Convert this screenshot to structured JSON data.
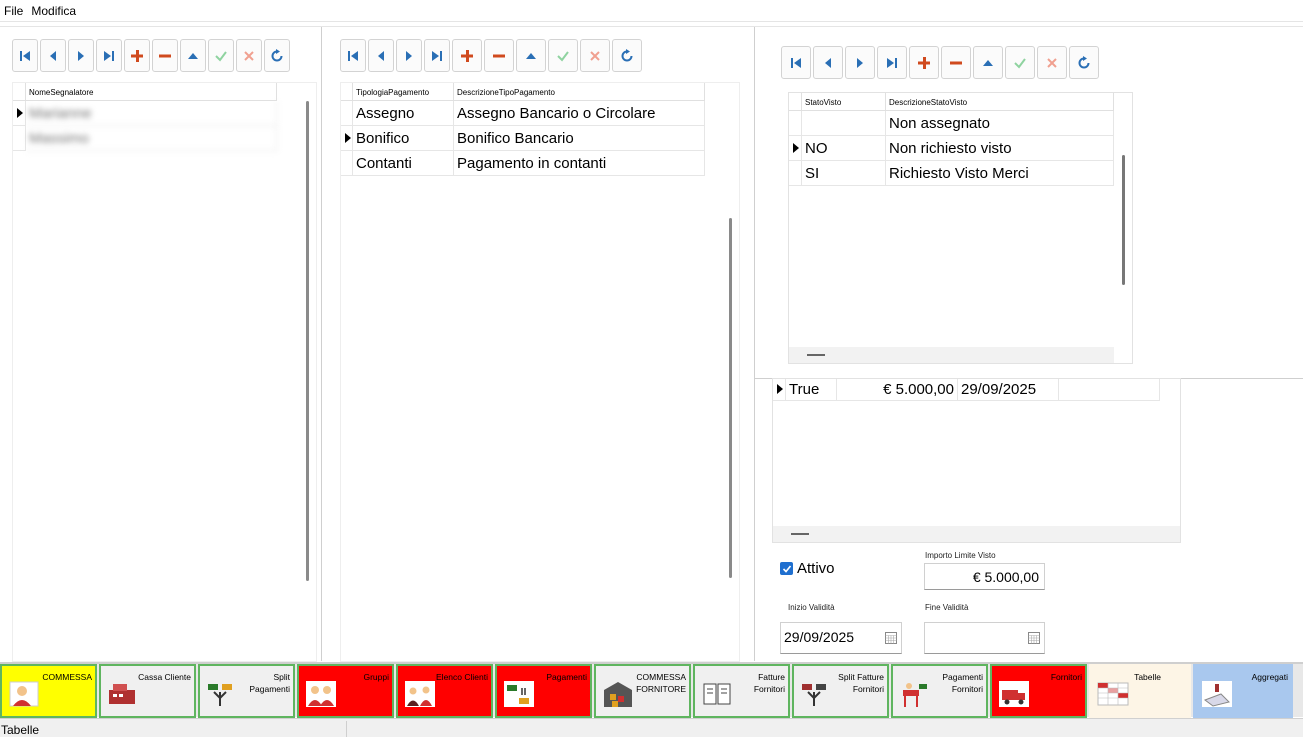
{
  "menu": {
    "file": "File",
    "modifica": "Modifica"
  },
  "icons": {
    "first": "first-record-icon",
    "prev": "previous-record-icon",
    "next": "next-record-icon",
    "last": "last-record-icon",
    "add": "add-icon",
    "remove": "remove-icon",
    "up": "up-icon",
    "confirm": "confirm-icon",
    "cancel": "cancel-icon",
    "refresh": "refresh-icon"
  },
  "panel1": {
    "header": [
      "NomeSegnalatore"
    ],
    "rows": [
      [
        "Marianne"
      ],
      [
        "Massimo"
      ]
    ]
  },
  "panel2": {
    "header": [
      "TipologiaPagamento",
      "DescrizioneTipoPagamento"
    ],
    "rows": [
      [
        "Assegno",
        "Assegno Bancario o Circolare"
      ],
      [
        "Bonifico",
        "Bonifico Bancario"
      ],
      [
        "Contanti",
        "Pagamento in contanti"
      ]
    ]
  },
  "panel3": {
    "header": [
      "StatoVisto",
      "DescrizioneStatoVisto"
    ],
    "rows": [
      [
        "",
        "Non assegnato"
      ],
      [
        "NO",
        "Non richiesto visto"
      ],
      [
        "SI",
        "Richiesto Visto Merci"
      ]
    ],
    "detail_row": [
      "True",
      "€ 5.000,00",
      "29/09/2025",
      ""
    ]
  },
  "form": {
    "attivo_label": "Attivo",
    "importo_label": "Importo Limite Visto",
    "importo_value": "€ 5.000,00",
    "inizio_label": "Inizio Validità",
    "inizio_value": "29/09/2025",
    "fine_label": "Fine Validità",
    "fine_value": ""
  },
  "tabs": [
    {
      "label": "COMMESSA",
      "bg": "#ffff00",
      "icon": "worker-icon"
    },
    {
      "label": "Cassa Cliente",
      "bg": "#f0f0f0",
      "icon": "cash-register-icon"
    },
    {
      "label": "Split\nPagamenti",
      "bg": "#f0f0f0",
      "icon": "split-payment-icon"
    },
    {
      "label": "Gruppi",
      "bg": "#ff0000",
      "icon": "group-icon"
    },
    {
      "label": "Elenco Clienti",
      "bg": "#ff0000",
      "icon": "clients-icon"
    },
    {
      "label": "Pagamenti",
      "bg": "#ff0000",
      "icon": "payment-icon"
    },
    {
      "label": "COMMESSA\nFORNITORE",
      "bg": "#f0f0f0",
      "icon": "warehouse-icon"
    },
    {
      "label": "Fatture\nFornitori",
      "bg": "#f0f0f0",
      "icon": "invoice-icon"
    },
    {
      "label": "Split Fatture\nFornitori",
      "bg": "#f0f0f0",
      "icon": "split-invoice-icon"
    },
    {
      "label": "Pagamenti\nFornitori",
      "bg": "#f0f0f0",
      "icon": "supplier-payment-icon"
    },
    {
      "label": "Fornitori",
      "bg": "#ff0000",
      "icon": "truck-icon"
    },
    {
      "label": "Tabelle",
      "bg": "#fdf5e6",
      "icon": "table-icon"
    },
    {
      "label": "Aggregati",
      "bg": "#a9c8ee",
      "icon": "aggregate-icon"
    }
  ],
  "status": {
    "text": "Tabelle"
  }
}
